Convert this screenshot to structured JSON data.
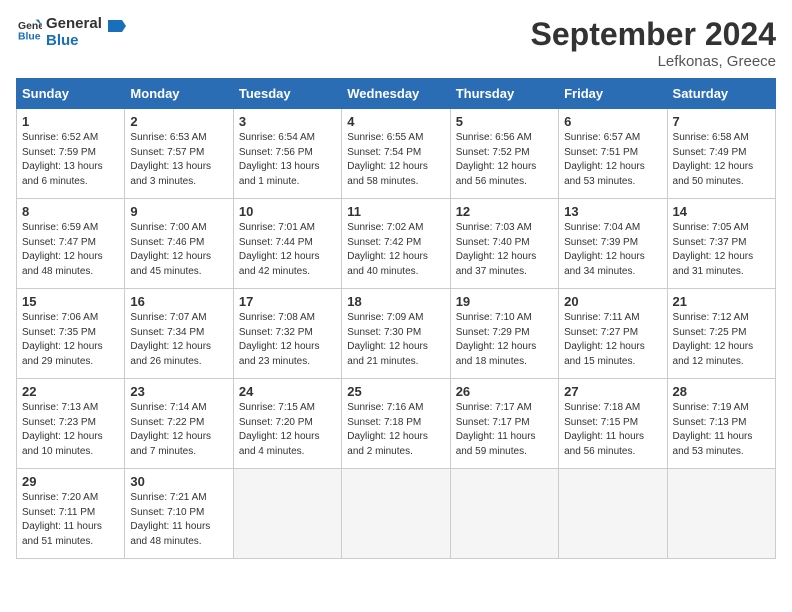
{
  "logo": {
    "line1": "General",
    "line2": "Blue"
  },
  "header": {
    "month": "September 2024",
    "location": "Lefkonas, Greece"
  },
  "days_of_week": [
    "Sunday",
    "Monday",
    "Tuesday",
    "Wednesday",
    "Thursday",
    "Friday",
    "Saturday"
  ],
  "weeks": [
    [
      {
        "day": "1",
        "info": "Sunrise: 6:52 AM\nSunset: 7:59 PM\nDaylight: 13 hours\nand 6 minutes."
      },
      {
        "day": "2",
        "info": "Sunrise: 6:53 AM\nSunset: 7:57 PM\nDaylight: 13 hours\nand 3 minutes."
      },
      {
        "day": "3",
        "info": "Sunrise: 6:54 AM\nSunset: 7:56 PM\nDaylight: 13 hours\nand 1 minute."
      },
      {
        "day": "4",
        "info": "Sunrise: 6:55 AM\nSunset: 7:54 PM\nDaylight: 12 hours\nand 58 minutes."
      },
      {
        "day": "5",
        "info": "Sunrise: 6:56 AM\nSunset: 7:52 PM\nDaylight: 12 hours\nand 56 minutes."
      },
      {
        "day": "6",
        "info": "Sunrise: 6:57 AM\nSunset: 7:51 PM\nDaylight: 12 hours\nand 53 minutes."
      },
      {
        "day": "7",
        "info": "Sunrise: 6:58 AM\nSunset: 7:49 PM\nDaylight: 12 hours\nand 50 minutes."
      }
    ],
    [
      {
        "day": "8",
        "info": "Sunrise: 6:59 AM\nSunset: 7:47 PM\nDaylight: 12 hours\nand 48 minutes."
      },
      {
        "day": "9",
        "info": "Sunrise: 7:00 AM\nSunset: 7:46 PM\nDaylight: 12 hours\nand 45 minutes."
      },
      {
        "day": "10",
        "info": "Sunrise: 7:01 AM\nSunset: 7:44 PM\nDaylight: 12 hours\nand 42 minutes."
      },
      {
        "day": "11",
        "info": "Sunrise: 7:02 AM\nSunset: 7:42 PM\nDaylight: 12 hours\nand 40 minutes."
      },
      {
        "day": "12",
        "info": "Sunrise: 7:03 AM\nSunset: 7:40 PM\nDaylight: 12 hours\nand 37 minutes."
      },
      {
        "day": "13",
        "info": "Sunrise: 7:04 AM\nSunset: 7:39 PM\nDaylight: 12 hours\nand 34 minutes."
      },
      {
        "day": "14",
        "info": "Sunrise: 7:05 AM\nSunset: 7:37 PM\nDaylight: 12 hours\nand 31 minutes."
      }
    ],
    [
      {
        "day": "15",
        "info": "Sunrise: 7:06 AM\nSunset: 7:35 PM\nDaylight: 12 hours\nand 29 minutes."
      },
      {
        "day": "16",
        "info": "Sunrise: 7:07 AM\nSunset: 7:34 PM\nDaylight: 12 hours\nand 26 minutes."
      },
      {
        "day": "17",
        "info": "Sunrise: 7:08 AM\nSunset: 7:32 PM\nDaylight: 12 hours\nand 23 minutes."
      },
      {
        "day": "18",
        "info": "Sunrise: 7:09 AM\nSunset: 7:30 PM\nDaylight: 12 hours\nand 21 minutes."
      },
      {
        "day": "19",
        "info": "Sunrise: 7:10 AM\nSunset: 7:29 PM\nDaylight: 12 hours\nand 18 minutes."
      },
      {
        "day": "20",
        "info": "Sunrise: 7:11 AM\nSunset: 7:27 PM\nDaylight: 12 hours\nand 15 minutes."
      },
      {
        "day": "21",
        "info": "Sunrise: 7:12 AM\nSunset: 7:25 PM\nDaylight: 12 hours\nand 12 minutes."
      }
    ],
    [
      {
        "day": "22",
        "info": "Sunrise: 7:13 AM\nSunset: 7:23 PM\nDaylight: 12 hours\nand 10 minutes."
      },
      {
        "day": "23",
        "info": "Sunrise: 7:14 AM\nSunset: 7:22 PM\nDaylight: 12 hours\nand 7 minutes."
      },
      {
        "day": "24",
        "info": "Sunrise: 7:15 AM\nSunset: 7:20 PM\nDaylight: 12 hours\nand 4 minutes."
      },
      {
        "day": "25",
        "info": "Sunrise: 7:16 AM\nSunset: 7:18 PM\nDaylight: 12 hours\nand 2 minutes."
      },
      {
        "day": "26",
        "info": "Sunrise: 7:17 AM\nSunset: 7:17 PM\nDaylight: 11 hours\nand 59 minutes."
      },
      {
        "day": "27",
        "info": "Sunrise: 7:18 AM\nSunset: 7:15 PM\nDaylight: 11 hours\nand 56 minutes."
      },
      {
        "day": "28",
        "info": "Sunrise: 7:19 AM\nSunset: 7:13 PM\nDaylight: 11 hours\nand 53 minutes."
      }
    ],
    [
      {
        "day": "29",
        "info": "Sunrise: 7:20 AM\nSunset: 7:11 PM\nDaylight: 11 hours\nand 51 minutes."
      },
      {
        "day": "30",
        "info": "Sunrise: 7:21 AM\nSunset: 7:10 PM\nDaylight: 11 hours\nand 48 minutes."
      },
      {
        "day": "",
        "info": ""
      },
      {
        "day": "",
        "info": ""
      },
      {
        "day": "",
        "info": ""
      },
      {
        "day": "",
        "info": ""
      },
      {
        "day": "",
        "info": ""
      }
    ]
  ]
}
